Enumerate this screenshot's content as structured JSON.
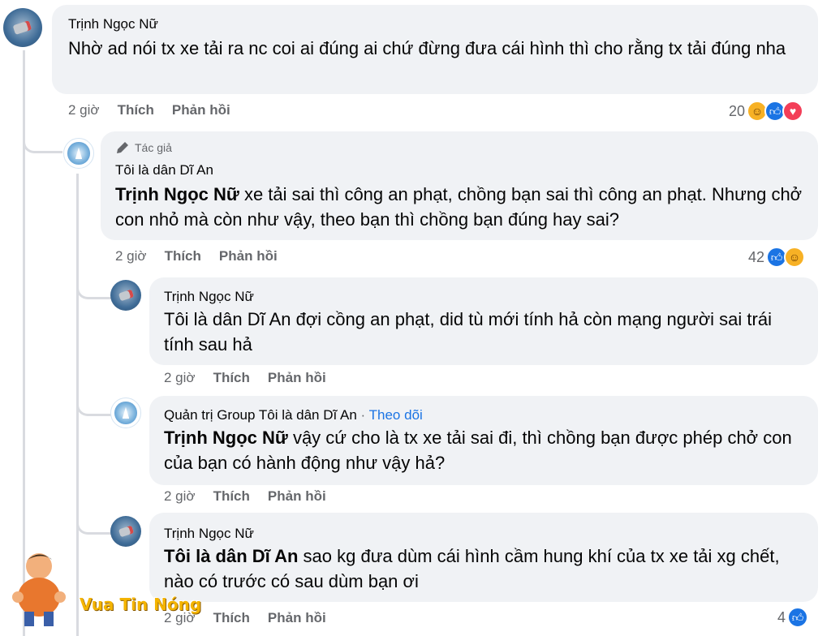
{
  "comments": [
    {
      "name": "Trịnh Ngọc Nữ",
      "text": "Nhờ ad nói tx xe tải ra nc coi ai đúng ai chứ đừng đưa cái hình thì cho rằng tx tải đúng nha",
      "time": "2 giờ",
      "like": "Thích",
      "reply": "Phản hồi",
      "reaction_count": "20"
    },
    {
      "badge": "Tác giả",
      "name": "Tôi là dân Dĩ An",
      "mention": "Trịnh Ngọc Nữ",
      "text": " xe tải sai thì công an phạt, chồng bạn sai thì công an phạt. Nhưng chở con nhỏ mà còn như vậy, theo bạn thì chồng bạn đúng hay sai?",
      "time": "2 giờ",
      "like": "Thích",
      "reply": "Phản hồi",
      "reaction_count": "42"
    },
    {
      "name": "Trịnh Ngọc Nữ",
      "mention": "",
      "text": "Tôi là dân Dĩ An đợi cồng an phạt, did tù mới tính hả còn mạng người sai trái tính sau hả",
      "time": "2 giờ",
      "like": "Thích",
      "reply": "Phản hồi"
    },
    {
      "name": "Quản trị Group Tôi là dân Dĩ An",
      "separator": " · ",
      "follow": "Theo dõi",
      "mention": "Trịnh Ngọc Nữ",
      "text": " vậy cứ cho là tx xe tải sai đi, thì chồng bạn được phép chở con của bạn có hành động như vậy hả?",
      "time": "2 giờ",
      "like": "Thích",
      "reply": "Phản hồi"
    },
    {
      "name": "Trịnh Ngọc Nữ",
      "mention": "Tôi là dân Dĩ An",
      "text": " sao kg đưa dùm cái hình cầm hung khí của tx xe tải xg chết, nào có trước có sau dùm bạn ơi",
      "time": "2 giờ",
      "like": "Thích",
      "reply": "Phản hồi",
      "reaction_count": "4"
    }
  ],
  "watermark": "Vua Tin Nóng",
  "colors": {
    "bubble": "#f0f2f5",
    "meta": "#65676b",
    "like_blue": "#1b74e4",
    "love_red": "#f33e58",
    "haha_yellow": "#f7b125"
  }
}
